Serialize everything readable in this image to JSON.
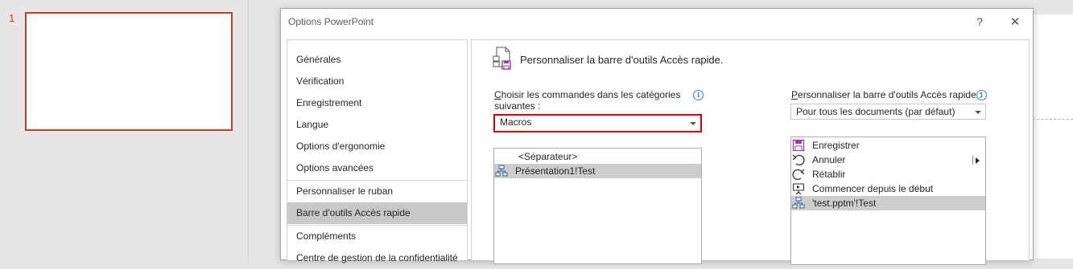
{
  "background": {
    "slide_number": "1",
    "accent_color": "#c43e1c"
  },
  "dialog": {
    "title": "Options PowerPoint",
    "help_glyph": "?",
    "close_glyph": "✕"
  },
  "nav": {
    "items": [
      {
        "label": "Générales",
        "selected": false
      },
      {
        "label": "Vérification",
        "selected": false
      },
      {
        "label": "Enregistrement",
        "selected": false
      },
      {
        "label": "Langue",
        "selected": false
      },
      {
        "label": "Options d'ergonomie",
        "selected": false
      },
      {
        "label": "Options avancées",
        "selected": false
      },
      {
        "label": "Personnaliser le ruban",
        "selected": false
      },
      {
        "label": "Barre d'outils Accès rapide",
        "selected": true
      },
      {
        "label": "Compléments",
        "selected": false
      },
      {
        "label": "Centre de gestion de la confidentialité",
        "selected": false
      }
    ]
  },
  "main": {
    "header_icon": "quick-access-toolbar-icon",
    "header_title": "Personnaliser la barre d'outils Accès rapide.",
    "choose_label_first": "C",
    "choose_label_rest": "hoisir les commandes dans les catégories",
    "choose_label_line2": "suivantes :",
    "choose_value": "Macros",
    "available_commands": [
      {
        "label": "<Séparateur>",
        "icon": "none",
        "selected": false
      },
      {
        "label": "Présentation1!Test",
        "icon": "macro-icon",
        "selected": true
      }
    ],
    "right_label_first": "P",
    "right_label_rest": "ersonnaliser la barre d'outils Accès rapide :",
    "right_value": "Pour tous les documents (par défaut)",
    "toolbar_commands": [
      {
        "label": "Enregistrer",
        "icon": "save-icon",
        "selected": false
      },
      {
        "label": "Annuler",
        "icon": "undo-icon",
        "selected": false
      },
      {
        "label": "Rétablir",
        "icon": "redo-icon",
        "selected": false
      },
      {
        "label": "Commencer depuis le début",
        "icon": "slideshow-start-icon",
        "selected": false
      },
      {
        "label": "'test.pptm'!Test",
        "icon": "macro-icon",
        "selected": true
      }
    ]
  },
  "colors": {
    "highlight_border": "#d40000",
    "selection": "#c8c8c8",
    "info": "#3a78c9",
    "save_icon": "#9a3fa3"
  }
}
